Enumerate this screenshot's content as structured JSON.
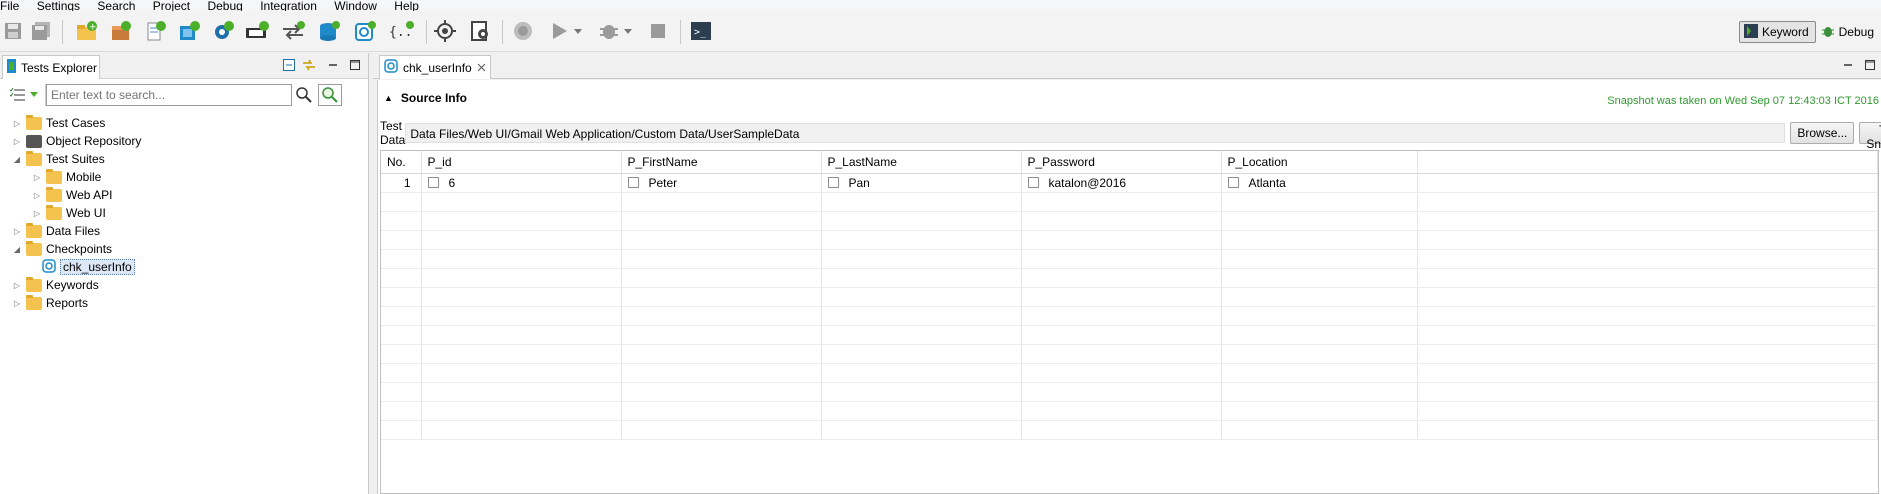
{
  "menu": [
    "File",
    "Settings",
    "Search",
    "Project",
    "Debug",
    "Integration",
    "Window",
    "Help"
  ],
  "toolbar": {
    "icons": [
      "save-icon",
      "save-all-icon",
      "new-folder-icon",
      "new-package-icon",
      "new-test-case-icon",
      "new-test-object-icon",
      "new-keyword-icon",
      "new-test-suite-icon",
      "new-test-suite-collection-icon",
      "new-test-data-icon",
      "new-checkpoint-icon",
      "new-custom-keyword-icon",
      "spy-web-icon",
      "record-web-icon",
      "run-icon",
      "run-dropdown-icon",
      "debug-icon",
      "debug-dropdown-icon",
      "stop-icon",
      "terminal-icon"
    ],
    "perspective": {
      "keyword": "Keyword",
      "debug": "Debug"
    }
  },
  "explorer": {
    "title": "Tests Explorer",
    "search_placeholder": "Enter text to search...",
    "tree": [
      {
        "label": "Test Cases",
        "expanded": false
      },
      {
        "label": "Object Repository",
        "expanded": false
      },
      {
        "label": "Test Suites",
        "expanded": true
      },
      {
        "label": "Mobile",
        "expanded": false
      },
      {
        "label": "Web API",
        "expanded": false
      },
      {
        "label": "Web UI",
        "expanded": false
      },
      {
        "label": "Data Files",
        "expanded": false
      },
      {
        "label": "Checkpoints",
        "expanded": true
      },
      {
        "label": "chk_userInfo",
        "selected": true
      },
      {
        "label": "Keywords",
        "expanded": false
      },
      {
        "label": "Reports",
        "expanded": false
      }
    ]
  },
  "editor": {
    "tab_label": "chk_userInfo",
    "section_title": "Source Info",
    "snapshot_msg": "Snapshot was taken on Wed Sep 07 12:43:03 ICT 2016",
    "test_data_label": "Test Data",
    "test_data_value": "Data Files/Web UI/Gmail Web Application/Custom Data/UserSampleData",
    "browse_label": "Browse...",
    "take_snapshot_label": "Take Snapshot",
    "columns": [
      "No.",
      "P_id",
      "P_FirstName",
      "P_LastName",
      "P_Password",
      "P_Location"
    ],
    "rows": [
      {
        "no": "1",
        "cells": [
          "6",
          "Peter",
          "Pan",
          "katalon@2016",
          "Atlanta"
        ]
      }
    ]
  },
  "colors": {
    "snapshot": "#2f9a2f",
    "folder": "#f4c24e",
    "accent_blue": "#1f8bc9"
  }
}
